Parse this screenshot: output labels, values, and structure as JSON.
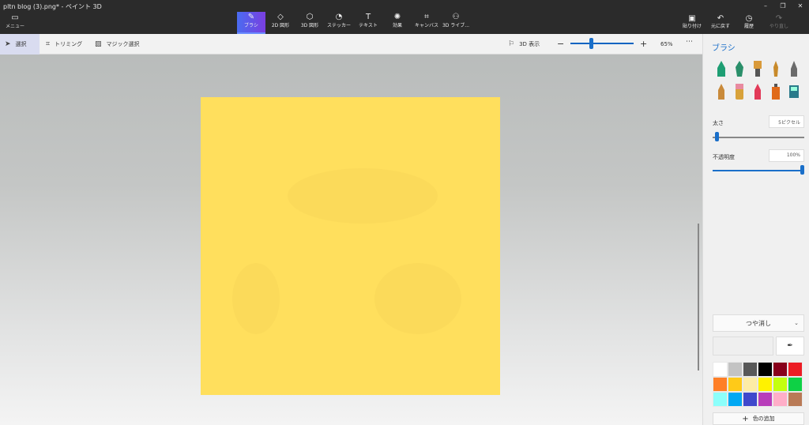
{
  "window": {
    "title": "pltn blog (3).png* - ペイント 3D"
  },
  "ribbon": {
    "menu_label": "メニュー",
    "tools": [
      {
        "label": "ブラシ",
        "icon": "brush-icon"
      },
      {
        "label": "2D 図形",
        "icon": "shapes-2d-icon"
      },
      {
        "label": "3D 図形",
        "icon": "cube-icon"
      },
      {
        "label": "ステッカー",
        "icon": "sticker-icon"
      },
      {
        "label": "テキスト",
        "icon": "text-icon"
      },
      {
        "label": "効果",
        "icon": "effects-icon"
      },
      {
        "label": "キャンバス",
        "icon": "canvas-icon"
      },
      {
        "label": "3D ライブ...",
        "icon": "library-icon"
      }
    ],
    "right_tools": [
      {
        "label": "貼り付け",
        "icon": "paste-icon"
      },
      {
        "label": "元に戻す",
        "icon": "undo-icon"
      },
      {
        "label": "履歴",
        "icon": "history-icon"
      },
      {
        "label": "やり直し",
        "icon": "redo-icon"
      }
    ]
  },
  "subbar": {
    "select_label": "選択",
    "crop_label": "トリミング",
    "magic_select_label": "マジック選択",
    "view3d_label": "3D 表示",
    "zoom_value": "65%",
    "zoom_level": 0.33
  },
  "panel": {
    "title": "ブラシ",
    "thickness_label": "太さ",
    "thickness_value": "5ピクセル",
    "thickness_level": 0.05,
    "opacity_label": "不透明度",
    "opacity_value": "100%",
    "opacity_level": 1.0,
    "finish_value": "つや消し",
    "add_color_label": "色の追加",
    "brush_colors": [
      "#1e9e73",
      "#2a8f6a",
      "#d99a3a",
      "#c88a2a",
      "#6a6a6a",
      "#c98a3a",
      "#d8a23a",
      "#e23a58",
      "#e06a1a",
      "#2a7a8a"
    ],
    "swatches": [
      "#ffffff",
      "#c3c3c3",
      "#585858",
      "#000000",
      "#88001b",
      "#ec1c24",
      "#ff7f27",
      "#ffca18",
      "#fdeca6",
      "#fff200",
      "#c4ff0e",
      "#0ed145",
      "#8cfffb",
      "#00a8f3",
      "#3f48cc",
      "#b83dba",
      "#ffaec8",
      "#b97a56"
    ]
  },
  "canvas": {
    "background": "#ffdf5d"
  }
}
